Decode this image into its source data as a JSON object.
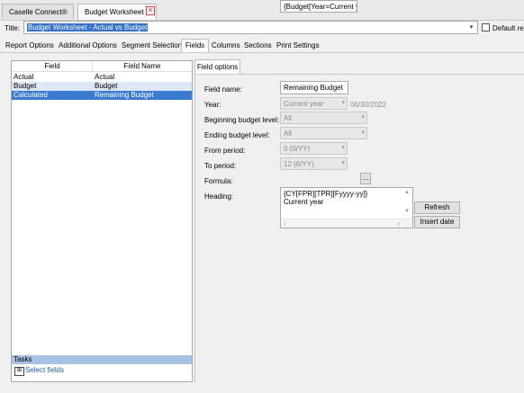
{
  "doc_tabs": [
    {
      "label": "Caselle Connect®"
    },
    {
      "label": "Budget Worksheet"
    }
  ],
  "title_row": {
    "label": "Title:",
    "value": "Budget Worksheet - Actual vs Budget",
    "default_label": "Default re"
  },
  "option_tabs": [
    "Report Options",
    "Additional Options",
    "Segment Selection",
    "Fields",
    "Columns",
    "Sections",
    "Print Settings"
  ],
  "fields_table": {
    "headers": [
      "Field",
      "Field Name"
    ],
    "rows": [
      {
        "field": "Actual",
        "name": "Actual"
      },
      {
        "field": "Budget",
        "name": "Budget"
      },
      {
        "field": "Calculated",
        "name": "Remaining Budget"
      }
    ]
  },
  "tasks": {
    "header": "Tasks",
    "items": [
      "Select fields"
    ]
  },
  "field_options": {
    "tab_label": "Field options",
    "field_name_label": "Field name:",
    "field_name_value": "Remaining Budget",
    "year_label": "Year:",
    "year_value": "Current year",
    "year_date": "06/30/2022",
    "begin_level_label": "Beginning budget level:",
    "begin_level_value": "All",
    "end_level_label": "Ending budget level:",
    "end_level_value": "All",
    "from_period_label": "From period:",
    "from_period_value": "0 (0/YY)",
    "to_period_label": "To period:",
    "to_period_value": "12 (6/YY)",
    "formula_label": "Formula:",
    "formula_value": "{Budget[Year=Current y",
    "formula_button": "...",
    "heading_label": "Heading:",
    "heading_line1": "{CY[FPR][TPR][Fyyyy-yy]}",
    "heading_line2": "Current year",
    "refresh_button": "Refresh",
    "insert_date_button": "Insert date"
  }
}
